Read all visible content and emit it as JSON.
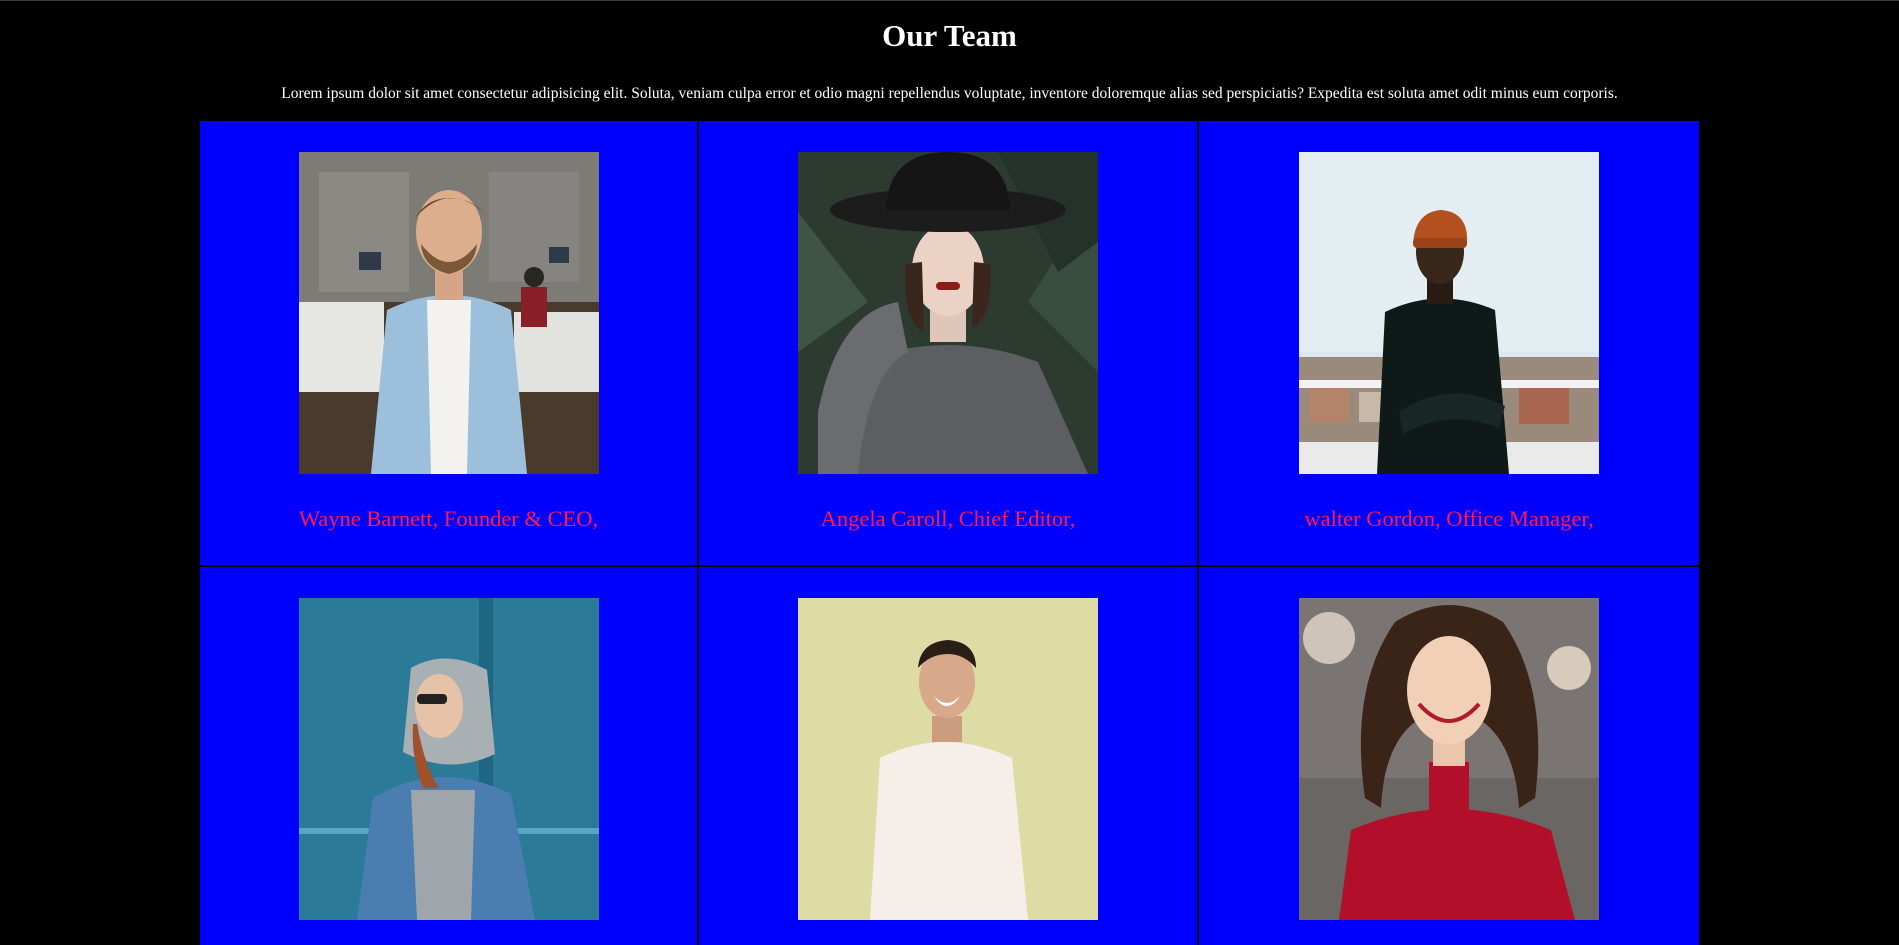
{
  "page": {
    "title": "Our Team",
    "intro": "Lorem ipsum dolor sit amet consectetur adipisicing elit. Soluta, veniam culpa error et odio magni repellendus voluptate, inventore doloremque alias sed perspiciatis? Expedita est soluta amet odit minus eum corporis."
  },
  "colors": {
    "page_background": "#000000",
    "card_background": "#0000ff",
    "caption_text": "#ff1a4b",
    "heading_text": "#ffffff"
  },
  "team": [
    {
      "caption": "Wayne Barnett, Founder & CEO,"
    },
    {
      "caption": "Angela Caroll, Chief Editor,"
    },
    {
      "caption": "walter Gordon, Office Manager,"
    },
    {
      "caption": ""
    },
    {
      "caption": ""
    },
    {
      "caption": ""
    }
  ]
}
